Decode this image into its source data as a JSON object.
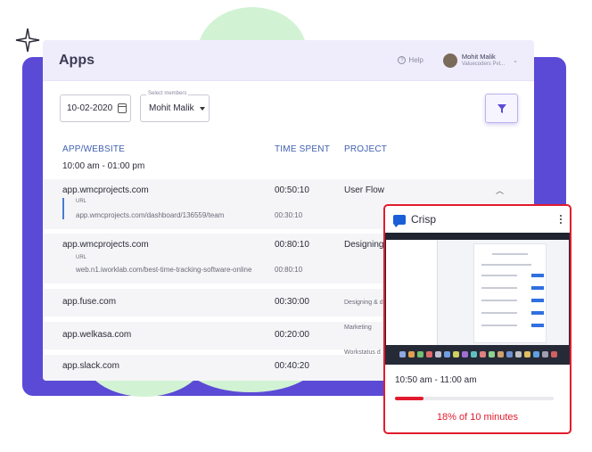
{
  "app": {
    "title": "Apps",
    "help_label": "Help",
    "user": {
      "name": "Mohit Malik",
      "org": "Valuecoders Pvt..."
    }
  },
  "filters": {
    "date": "10-02-2020",
    "member_label": "Select members",
    "member_value": "Mohit Malik"
  },
  "columns": {
    "app": "APP/WEBSITE",
    "time": "TIME SPENT",
    "project": "PROJECT"
  },
  "time_range": "10:00 am - 01:00 pm",
  "rows": [
    {
      "app": "app.wmcprojects.com",
      "time": "00:50:10",
      "project": "User Flow",
      "url_label": "URL",
      "url": "app.wmcprojects.com/dashboard/136559/team",
      "url_time": "00:30:10"
    },
    {
      "app": "app.wmcprojects.com",
      "time": "00:80:10",
      "project": "Designing",
      "url_label": "URL",
      "url": "web.n1.iworklab.com/best-time-tracking-software-online",
      "url_time": "00:80:10"
    },
    {
      "app": "app.fuse.com",
      "time": "00:30:00",
      "project": "Designing & d"
    },
    {
      "app": "app.welkasa.com",
      "time": "00:20:00",
      "project": "Marketing"
    },
    {
      "app": "app.slack.com",
      "time": "00:40:20",
      "project": "Workstatus d"
    }
  ],
  "crisp": {
    "title": "Crisp",
    "time_range": "10:50 am - 11:00 am",
    "progress_fraction": 0.18,
    "progress_label": "18% of 10 minutes"
  },
  "colors": {
    "accent": "#5b4ad6",
    "link_blue": "#3f5fb0",
    "alert_red": "#e21b2e",
    "blob_green": "#d2f2d4"
  },
  "icons": [
    "help-icon",
    "calendar-icon",
    "caret-down-icon",
    "filter-icon",
    "chevron-up-icon",
    "crisp-logo-icon",
    "kebab-menu-icon",
    "sparkle-icon"
  ]
}
